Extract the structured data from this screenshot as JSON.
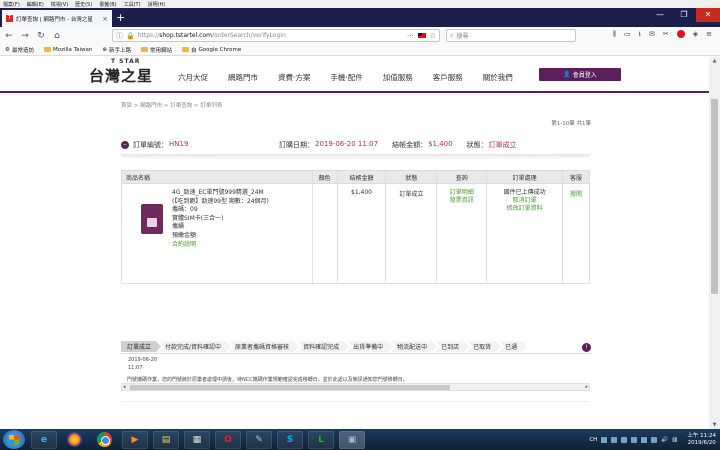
{
  "browser": {
    "menu": [
      "檔案(F)",
      "編輯(E)",
      "檢視(V)",
      "歷史(S)",
      "書籤(B)",
      "工具(T)",
      "說明(H)"
    ],
    "tab_title": "訂單查詢 | 網路門市 - 台灣之星",
    "url_scheme": "https://",
    "url_host": "shop.tstartel.com",
    "url_path": "/orderSearch/verifyLogin",
    "search_placeholder": "搜尋",
    "bookmarks": [
      "最常造訪",
      "Mozilla Taiwan",
      "新手上路",
      "常用網站",
      "Google Chrome"
    ]
  },
  "site": {
    "logo_small": "T STAR",
    "logo_main": "台灣之星",
    "nav": [
      "六月大促",
      "網路門市",
      "資費·方案",
      "手機·配件",
      "加值服務",
      "客戶服務",
      "關於我們"
    ],
    "login_label": "會員登入"
  },
  "breadcrumb": "首頁 > 網路門市 > 訂單查詢 > 訂單列表",
  "pageinfo": "第1-10筆 共1筆",
  "order": {
    "no_label": "訂單編號：",
    "no_value": "HN19",
    "date_label": "訂購日期：",
    "date_value": "2019-06-20 11:07",
    "amount_label": "結帳金額：",
    "amount_value": "$1,400",
    "status_label": "狀態：",
    "status_value": "訂單成立"
  },
  "table": {
    "headers": [
      "商品名稱",
      "顏色",
      "結帳金額",
      "狀態",
      "查詢",
      "訂單處理",
      "客服"
    ],
    "product_lines": [
      "4G_勁速_EC單門號999精選_24M",
      "(【吃到飽】勁速99型 期數：24個月)",
      "攜碼：09",
      "實體SIM卡(三合一)",
      "攜續",
      "預繳金額"
    ],
    "product_link": "合約說明",
    "amount": "$1,400",
    "status": "訂單成立",
    "query_links": [
      "訂單明細",
      "發票資訊"
    ],
    "process_lines": [
      "國件已上傳成功",
      "取消訂單",
      "修改訂單資料"
    ],
    "service_link": "撥開"
  },
  "steps": [
    "訂單成立",
    "付款完成/資料確認中",
    "原業者攜碼資格審核",
    "資料確認完成",
    "出貨準備中",
    "物流配送中",
    "已到店",
    "已取貨",
    "已通"
  ],
  "step_date": "2019-06-20",
  "step_time": "11:07",
  "notice": "門號攜碼作業，您的門號將於原業者處理中請後，待NCC攜碼作業規範確認完成移轉日，並於此處以及簡訊通知您門號移轉日。",
  "taskbar": {
    "lang": "CH",
    "time": "上午 11:24",
    "date": "2019/6/20"
  }
}
